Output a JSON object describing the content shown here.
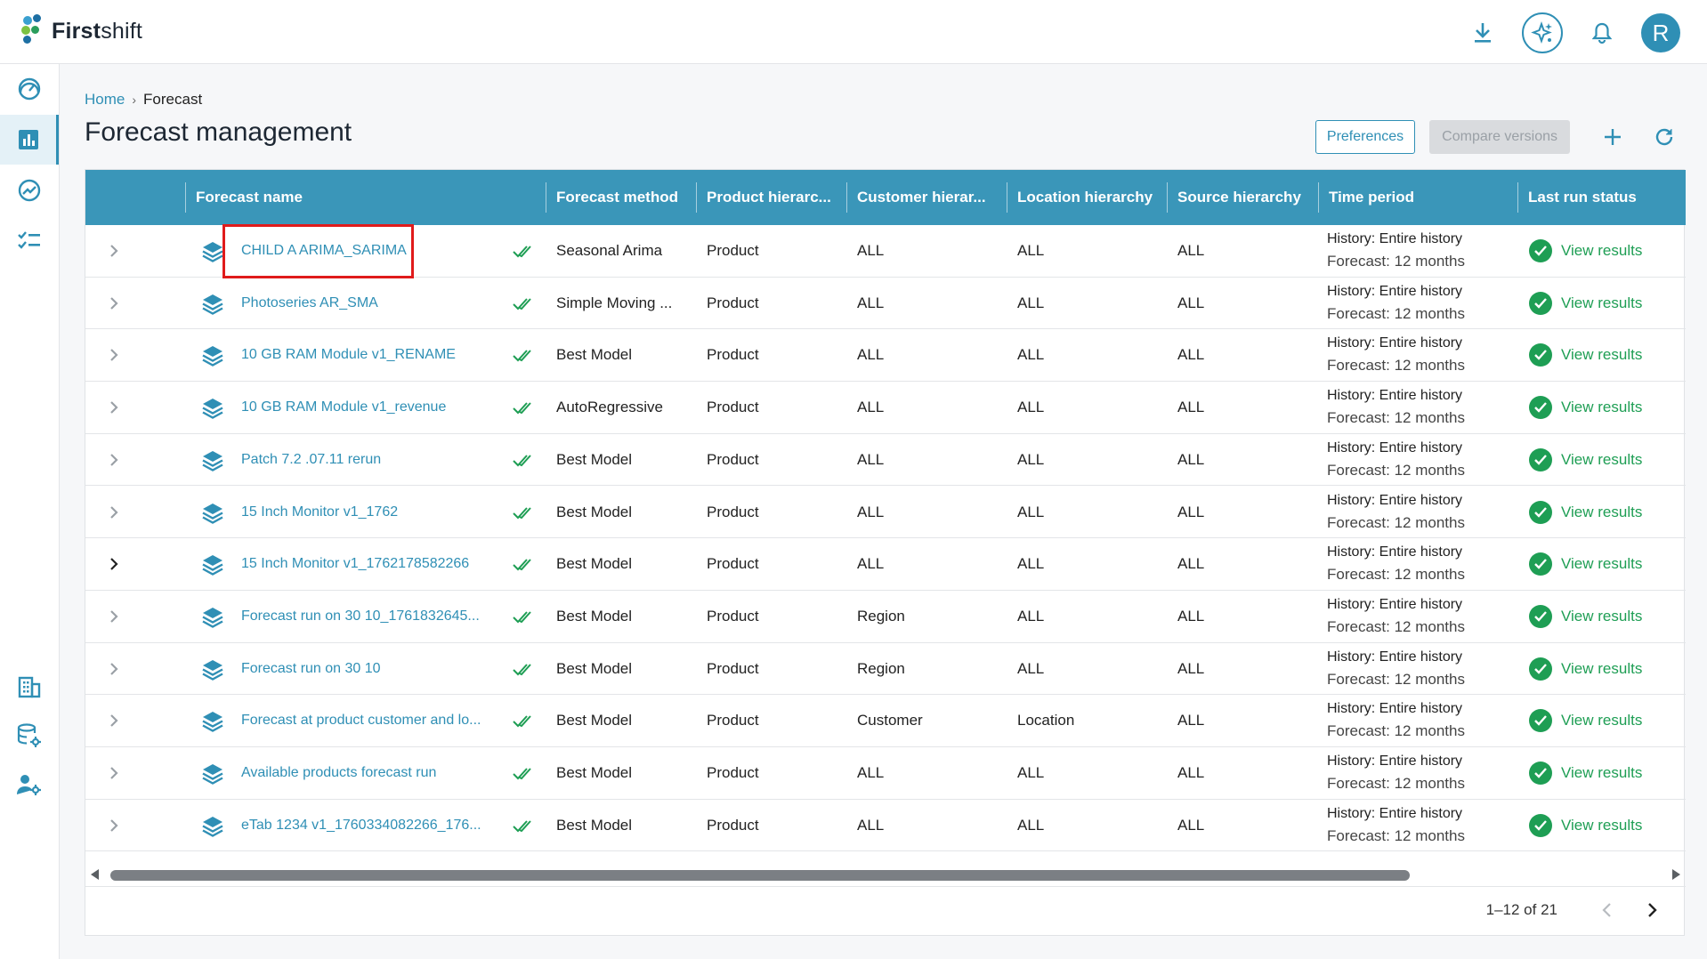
{
  "app": {
    "logo_text_bold": "First",
    "logo_text_light": "shift",
    "avatar_letter": "R"
  },
  "breadcrumb": {
    "home": "Home",
    "separator": "›",
    "current": "Forecast"
  },
  "page": {
    "title": "Forecast management"
  },
  "actions": {
    "preferences": "Preferences",
    "compare_versions": "Compare versions"
  },
  "table": {
    "columns": [
      "Forecast name",
      "Forecast method",
      "Product hierarc...",
      "Customer hierar...",
      "Location hierarchy",
      "Source hierarchy",
      "Time period",
      "Last run status"
    ],
    "rows": [
      {
        "name": "CHILD A ARIMA_SARIMA",
        "method": "Seasonal Arima",
        "product": "Product",
        "customer": "ALL",
        "location": "ALL",
        "source": "ALL",
        "history": "History: Entire history",
        "forecast": "Forecast: 12 months",
        "status": "View results"
      },
      {
        "name": "Photoseries AR_SMA",
        "method": "Simple Moving ...",
        "product": "Product",
        "customer": "ALL",
        "location": "ALL",
        "source": "ALL",
        "history": "History: Entire history",
        "forecast": "Forecast: 12 months",
        "status": "View results"
      },
      {
        "name": "10 GB RAM Module v1_RENAME",
        "method": "Best Model",
        "product": "Product",
        "customer": "ALL",
        "location": "ALL",
        "source": "ALL",
        "history": "History: Entire history",
        "forecast": "Forecast: 12 months",
        "status": "View results"
      },
      {
        "name": "10 GB RAM Module v1_revenue",
        "method": "AutoRegressive",
        "product": "Product",
        "customer": "ALL",
        "location": "ALL",
        "source": "ALL",
        "history": "History: Entire history",
        "forecast": "Forecast: 12 months",
        "status": "View results"
      },
      {
        "name": "Patch 7.2 .07.11 rerun",
        "method": "Best Model",
        "product": "Product",
        "customer": "ALL",
        "location": "ALL",
        "source": "ALL",
        "history": "History: Entire history",
        "forecast": "Forecast: 12 months",
        "status": "View results"
      },
      {
        "name": "15 Inch Monitor v1_1762",
        "method": "Best Model",
        "product": "Product",
        "customer": "ALL",
        "location": "ALL",
        "source": "ALL",
        "history": "History: Entire history",
        "forecast": "Forecast: 12 months",
        "status": "View results"
      },
      {
        "name": "15 Inch Monitor v1_1762178582266",
        "method": "Best Model",
        "product": "Product",
        "customer": "ALL",
        "location": "ALL",
        "source": "ALL",
        "history": "History: Entire history",
        "forecast": "Forecast: 12 months",
        "status": "View results"
      },
      {
        "name": "Forecast run on 30 10_1761832645...",
        "method": "Best Model",
        "product": "Product",
        "customer": "Region",
        "location": "ALL",
        "source": "ALL",
        "history": "History: Entire history",
        "forecast": "Forecast: 12 months",
        "status": "View results"
      },
      {
        "name": "Forecast run on 30 10",
        "method": "Best Model",
        "product": "Product",
        "customer": "Region",
        "location": "ALL",
        "source": "ALL",
        "history": "History: Entire history",
        "forecast": "Forecast: 12 months",
        "status": "View results"
      },
      {
        "name": "Forecast at product customer and lo...",
        "method": "Best Model",
        "product": "Product",
        "customer": "Customer",
        "location": "Location",
        "source": "ALL",
        "history": "History: Entire history",
        "forecast": "Forecast: 12 months",
        "status": "View results"
      },
      {
        "name": "Available products forecast run",
        "method": "Best Model",
        "product": "Product",
        "customer": "ALL",
        "location": "ALL",
        "source": "ALL",
        "history": "History: Entire history",
        "forecast": "Forecast: 12 months",
        "status": "View results"
      },
      {
        "name": "eTab 1234 v1_1760334082266_176...",
        "method": "Best Model",
        "product": "Product",
        "customer": "ALL",
        "location": "ALL",
        "source": "ALL",
        "history": "History: Entire history",
        "forecast": "Forecast: 12 months",
        "status": "View results"
      }
    ]
  },
  "pagination": {
    "range": "1–12 of 21"
  },
  "colors": {
    "accent": "#3a96b9",
    "link": "#2f8fb5",
    "success": "#1e9e54",
    "highlight": "#e01b1b"
  },
  "icons": {
    "sidebar": [
      "dashboard-icon",
      "forecast-chart-icon",
      "trend-icon",
      "checklist-icon",
      "building-icon",
      "database-settings-icon",
      "user-settings-icon"
    ],
    "topbar": [
      "download-icon",
      "ai-sparkle-icon",
      "bell-icon"
    ]
  }
}
